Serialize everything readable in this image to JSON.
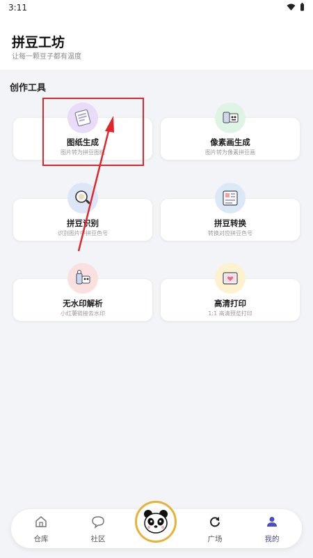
{
  "status": {
    "time": "3:11"
  },
  "header": {
    "title": "拼豆工坊",
    "subtitle": "让每一颗豆子都有温度"
  },
  "section": {
    "title": "创作工具"
  },
  "tools": [
    {
      "title": "图纸生成",
      "subtitle": "图片转为拼豆图纸",
      "icon": "blueprint-icon",
      "color": "#e8dcf8"
    },
    {
      "title": "像素画生成",
      "subtitle": "图片转为像素拼豆画",
      "icon": "pixel-art-icon",
      "color": "#dff4e4"
    },
    {
      "title": "拼豆识别",
      "subtitle": "识别图片中拼豆色号",
      "icon": "magnifier-icon",
      "color": "#dde6f6"
    },
    {
      "title": "拼豆转换",
      "subtitle": "转换对应拼豆色号",
      "icon": "convert-icon",
      "color": "#dbe9f7"
    },
    {
      "title": "无水印解析",
      "subtitle": "小红薯链接去水印",
      "icon": "watermark-icon",
      "color": "#fbe0e0"
    },
    {
      "title": "高清打印",
      "subtitle": "1:1 高清预览打印",
      "icon": "print-icon",
      "color": "#fcf2cf"
    }
  ],
  "nav": {
    "items": [
      {
        "label": "仓库",
        "icon": "home-icon"
      },
      {
        "label": "社区",
        "icon": "chat-icon"
      },
      {
        "label": "广场",
        "icon": "refresh-icon"
      },
      {
        "label": "我的",
        "icon": "person-icon"
      }
    ],
    "center_icon": "panda-icon",
    "active_index": 3
  },
  "colors": {
    "accent": "#e6b23a",
    "annotation": "#e0252b",
    "active_nav": "#4b4bcf"
  }
}
